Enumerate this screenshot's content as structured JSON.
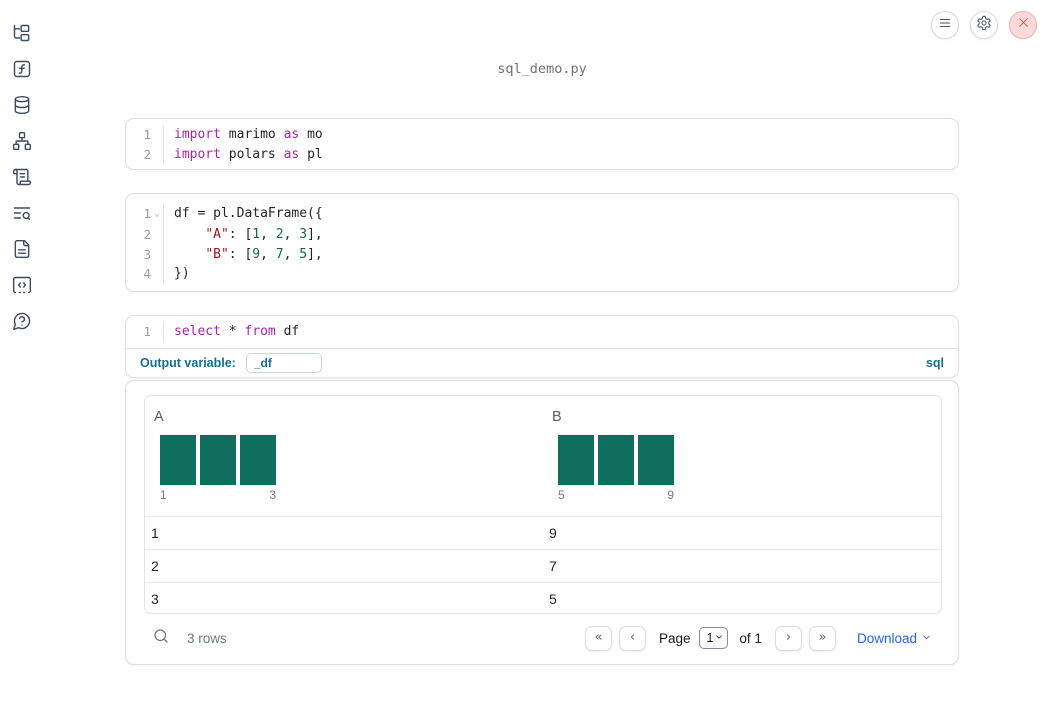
{
  "title": "sql_demo.py",
  "icons": {
    "fold_icon": "⌄"
  },
  "sidebar": {
    "items": [
      {
        "icon": "file-tree-icon"
      },
      {
        "icon": "function-square-icon"
      },
      {
        "icon": "database-icon"
      },
      {
        "icon": "dependency-graph-icon"
      },
      {
        "icon": "scroll-icon"
      },
      {
        "icon": "list-search-icon"
      },
      {
        "icon": "document-icon"
      },
      {
        "icon": "code-snippet-icon"
      },
      {
        "icon": "help-circle-icon"
      }
    ]
  },
  "cells": [
    {
      "name": "imports-cell",
      "lines": [
        {
          "n": "1",
          "tokens": [
            [
              "kw",
              "import"
            ],
            [
              "pl",
              " marimo "
            ],
            [
              "kw",
              "as"
            ],
            [
              "pl",
              " mo"
            ]
          ]
        },
        {
          "n": "2",
          "tokens": [
            [
              "kw",
              "import"
            ],
            [
              "pl",
              " polars "
            ],
            [
              "kw",
              "as"
            ],
            [
              "pl",
              " pl"
            ]
          ]
        }
      ]
    },
    {
      "name": "dataframe-cell",
      "lines": [
        {
          "n": "1",
          "fold": true,
          "tokens": [
            [
              "pl",
              "df = pl.DataFrame({"
            ]
          ]
        },
        {
          "n": "2",
          "tokens": [
            [
              "pl",
              "    "
            ],
            [
              "str",
              "\"A\""
            ],
            [
              "pl",
              ": ["
            ],
            [
              "num",
              "1"
            ],
            [
              "pl",
              ", "
            ],
            [
              "num",
              "2"
            ],
            [
              "pl",
              ", "
            ],
            [
              "num",
              "3"
            ],
            [
              "pl",
              "],"
            ]
          ]
        },
        {
          "n": "3",
          "tokens": [
            [
              "pl",
              "    "
            ],
            [
              "str",
              "\"B\""
            ],
            [
              "pl",
              ": ["
            ],
            [
              "num",
              "9"
            ],
            [
              "pl",
              ", "
            ],
            [
              "num",
              "7"
            ],
            [
              "pl",
              ", "
            ],
            [
              "num",
              "5"
            ],
            [
              "pl",
              "],"
            ]
          ]
        },
        {
          "n": "4",
          "tokens": [
            [
              "pl",
              "})"
            ]
          ]
        }
      ]
    },
    {
      "name": "sql-cell",
      "lines": [
        {
          "n": "1",
          "tokens": [
            [
              "kw",
              "select"
            ],
            [
              "pl",
              " * "
            ],
            [
              "kw",
              "from"
            ],
            [
              "pl",
              " df"
            ]
          ]
        }
      ]
    }
  ],
  "sql_meta": {
    "output_variable_label": "Output variable:",
    "output_variable_value": "_df",
    "language_badge": "sql"
  },
  "table": {
    "columns": [
      {
        "name": "A",
        "values": [
          1,
          2,
          3
        ],
        "hist": {
          "bar_count": 3,
          "min_label": "1",
          "max_label": "3"
        }
      },
      {
        "name": "B",
        "values": [
          9,
          7,
          5
        ],
        "hist": {
          "bar_count": 3,
          "min_label": "5",
          "max_label": "9"
        }
      }
    ],
    "rows": [
      [
        "1",
        "9"
      ],
      [
        "2",
        "7"
      ],
      [
        "3",
        "5"
      ]
    ],
    "row_count_label": "3 rows",
    "pagination": {
      "page_label": "Page",
      "page_value": "1",
      "of_label": "of 1",
      "first_icon": "«",
      "prev_icon": "‹",
      "next_icon": "›",
      "last_icon": "»"
    },
    "download_label": "Download"
  },
  "colors": {
    "histogram_bar": "#0e6f5f",
    "keyword": "#a626a4",
    "string": "#a31515",
    "number": "#116644",
    "label_blue": "#13708f",
    "download_blue": "#2563eb",
    "close_red": "#c4554d"
  }
}
